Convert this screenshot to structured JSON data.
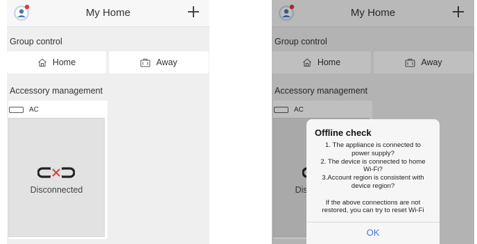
{
  "colors": {
    "accent_blue": "#3a7bd5",
    "notification_red": "#e53935",
    "screen_bg": "#efefef",
    "card_placeholder": "#e2e2e2"
  },
  "header": {
    "title": "My Home",
    "add_icon": "plus-icon",
    "avatar_icon": "avatar-icon"
  },
  "group_control": {
    "title": "Group control",
    "home_label": "Home",
    "home_icon": "house-icon",
    "away_label": "Away",
    "away_icon": "suitcase-icon"
  },
  "accessory_management": {
    "title": "Accessory management",
    "device": {
      "name": "AC",
      "icon": "ac-unit-icon",
      "status": "Disconnected",
      "status_icon": "disconnected-link-icon"
    }
  },
  "offline_dialog": {
    "title": "Offline check",
    "lines": [
      "1. The appliance is connected to",
      "power supply?",
      "2. The device is connected to home",
      "Wi-Fi?",
      "3.Account region is consistent with",
      "device region?",
      "",
      "If the above connections are not",
      "restored, you can try to reset Wi-Fi"
    ],
    "ok_label": "OK"
  }
}
